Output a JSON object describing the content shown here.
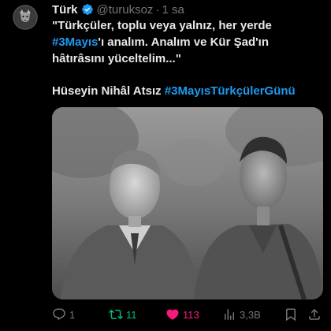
{
  "tweet": {
    "author_name": "Türk",
    "handle": "@turuksoz",
    "separator": "·",
    "time": "1 sa",
    "text": {
      "line1": "\"Türkçüler, toplu veya yalnız, her yerde",
      "hashtag1": "#3Mayıs",
      "line2_rest": "'ı analım. Analım ve Kür Şad'ın",
      "line3": "hâtırâsını yüceltelim...\"",
      "signature_name": "Hüseyin Nihâl Atsız",
      "hashtag2": "#3MayısTürkçülerGünü"
    },
    "media": {
      "kind": "black-and-white photo of two men"
    },
    "actions": {
      "reply_count": "1",
      "retweet_count": "11",
      "like_count": "113",
      "views_count": "3,3B"
    },
    "colors": {
      "background": "#000000",
      "text": "#e7e9ea",
      "muted": "#71767b",
      "link": "#1d9bf0",
      "retweet": "#00ba7c",
      "like": "#f91880",
      "verified": "#1d9bf0"
    }
  }
}
